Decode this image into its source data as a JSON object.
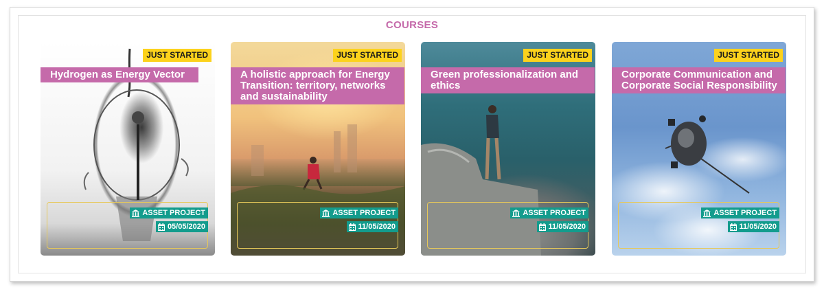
{
  "section": {
    "title": "COURSES"
  },
  "cards": [
    {
      "badge": "JUST STARTED",
      "title": "Hydrogen as Energy Vector",
      "project": "ASSET PROJECT",
      "date": "05/05/2020"
    },
    {
      "badge": "JUST STARTED",
      "title": "A holistic approach for Energy Transition: territory, networks and sustainability",
      "project": "ASSET PROJECT",
      "date": "11/05/2020"
    },
    {
      "badge": "JUST STARTED",
      "title": "Green professionalization and ethics",
      "project": "ASSET PROJECT",
      "date": "11/05/2020"
    },
    {
      "badge": "JUST STARTED",
      "title": "Corporate Communication and Corporate Social Responsibility",
      "project": "ASSET PROJECT",
      "date": "11/05/2020"
    }
  ],
  "colors": {
    "accent": "#c56aaa",
    "badge": "#fcd21c",
    "tag": "#139c8d",
    "box_border": "#e6c85a"
  },
  "icons": {
    "project": "bank-icon",
    "date": "calendar-icon"
  }
}
